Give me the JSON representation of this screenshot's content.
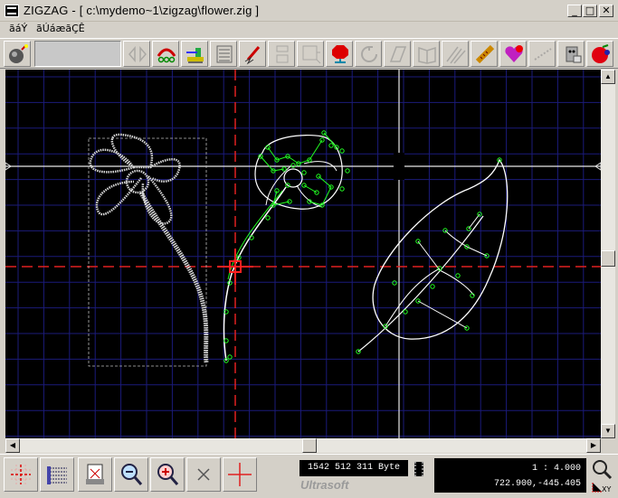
{
  "window": {
    "title": "ZIGZAG - [ c:\\mydemo~1\\zigzag\\flower.zig ]",
    "minimize_label": "_",
    "maximize_label": "□",
    "close_label": "✕"
  },
  "menu": {
    "items": [
      "ãáÝ",
      "ãÚáæãÇÊ"
    ]
  },
  "toolbar": {
    "icons": [
      "bomb-icon",
      "flip-icon",
      "chain-icon",
      "sewing-machine-icon",
      "text-lines-icon",
      "pen-icon",
      "spool-icon",
      "frame-icon",
      "stop-icon",
      "rotate-icon",
      "shape-icon",
      "book-icon",
      "stripes-icon",
      "ruler-icon",
      "heart-icon",
      "dots-icon",
      "robot-icon",
      "apple-icon"
    ]
  },
  "status": {
    "file_size": "1542 512 311 Byte",
    "brand": "Ultrasoft",
    "scale": "1 : 4.000",
    "coordinates": "722.900,-445.405"
  },
  "bottom_toolbar": {
    "icons": [
      "grid-cross-icon",
      "stitch-list-icon",
      "print-preview-icon",
      "zoom-out-icon",
      "zoom-in-icon",
      "close-x-icon",
      "crosshair-icon"
    ]
  },
  "colors": {
    "canvas_bg": "#000000",
    "grid": "#1b1b7a",
    "red_guide": "#e02020",
    "design_stroke": "#ffffff",
    "selection": "#22ff22"
  }
}
